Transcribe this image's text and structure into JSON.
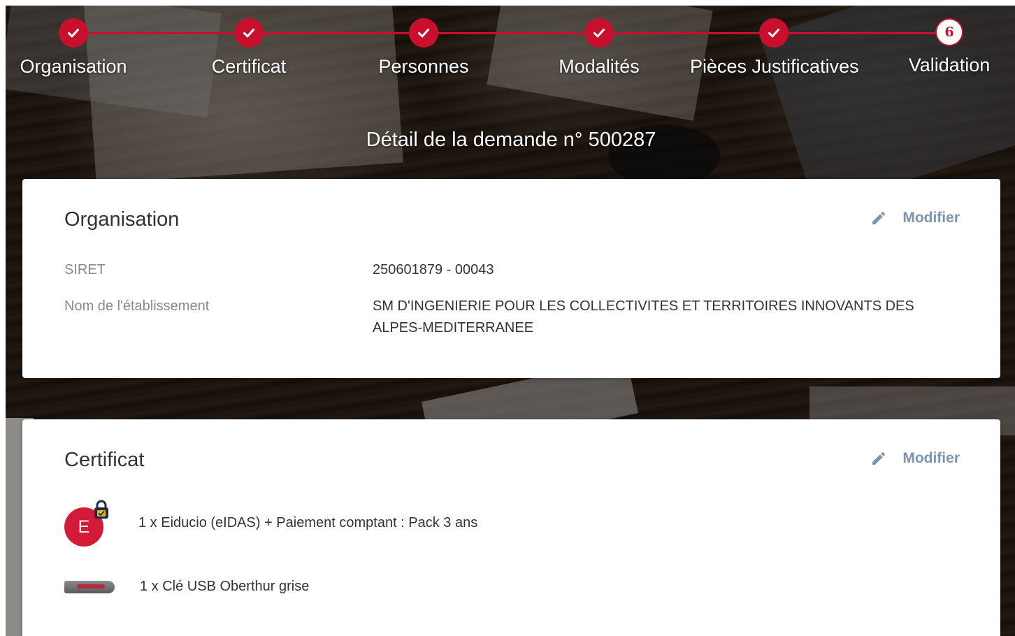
{
  "stepper": {
    "steps": [
      {
        "label": "Organisation",
        "state": "done"
      },
      {
        "label": "Certificat",
        "state": "done"
      },
      {
        "label": "Personnes",
        "state": "done"
      },
      {
        "label": "Modalités",
        "state": "done"
      },
      {
        "label": "Pièces Justificatives",
        "state": "done"
      },
      {
        "label": "Validation",
        "state": "current",
        "number": "6"
      }
    ]
  },
  "page": {
    "title": "Détail de la demande n° 500287"
  },
  "organisation_card": {
    "title": "Organisation",
    "edit_label": "Modifier",
    "fields": [
      {
        "label": "SIRET",
        "value": "250601879 - 00043"
      },
      {
        "label": "Nom de l'établissement",
        "value": "SM D'INGENIERIE POUR LES COLLECTIVITES ET TERRITOIRES INNOVANTS DES ALPES-MEDITERRANEE"
      }
    ]
  },
  "certificat_card": {
    "title": "Certificat",
    "edit_label": "Modifier",
    "items": [
      {
        "text": "1 x Eiducio (eIDAS) + Paiement comptant : Pack 3 ans",
        "icon": "eiducio-logo-icon",
        "logo_letter": "E"
      },
      {
        "text": "1 x Clé USB Oberthur grise",
        "icon": "usb-key-icon"
      }
    ]
  },
  "colors": {
    "accent": "#c8102e",
    "edit_link": "#7e94ab",
    "label_gray": "#8a8a8a",
    "text_dark": "#333333"
  }
}
